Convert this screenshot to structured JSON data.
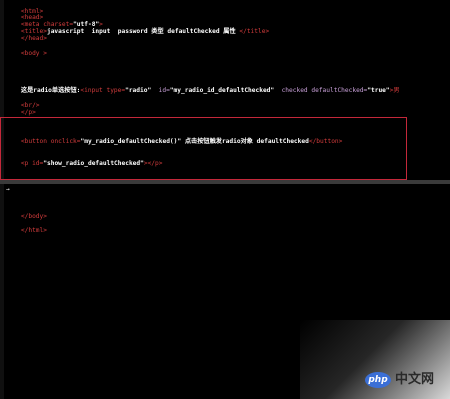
{
  "code": {
    "line1": "<html>",
    "line2": "<head>",
    "line3_tag": "<meta charset=",
    "line3_val": "\"utf-8\"",
    "line3_end": ">",
    "line4_open": "<title>",
    "line4_text": "javascript  input  password 类型 defaultChecked 属性 ",
    "line4_close": "</title>",
    "line5": "</head>",
    "line6": "<body >",
    "line7_text": "这是radio单选按钮:",
    "line7_tag": "<input type=",
    "line7_v1": "\"radio\"",
    "line7_id": "  id=",
    "line7_v2": "\"my_radio_id_defaultChecked\"",
    "line7_attr": "  checked defaultChecked=",
    "line7_v3": "\"true\"",
    "line7_end": ">男",
    "line8": "<br/>",
    "line9": "</p>",
    "line10_tag": "<button onclick=",
    "line10_val": "\"my_radio_defaultChecked()\"",
    "line10_text": " 点击按钮触发radio对象 defaultChecked",
    "line10_close": "</button>",
    "line11_tag": "<p id=",
    "line11_val": "\"show_radio_defaultChecked\"",
    "line11_close": "></p>",
    "line12": "</body>",
    "line13": "</html>",
    "cursor": "→"
  },
  "watermark": {
    "logo": "php",
    "text": "中文网"
  },
  "colors": {
    "background": "#000000",
    "tag": "#d23c3c",
    "attribute": "#c8a0d8",
    "string": "#ffffff",
    "highlight_border": "#c4283a",
    "divider": "#3a3a3a"
  }
}
